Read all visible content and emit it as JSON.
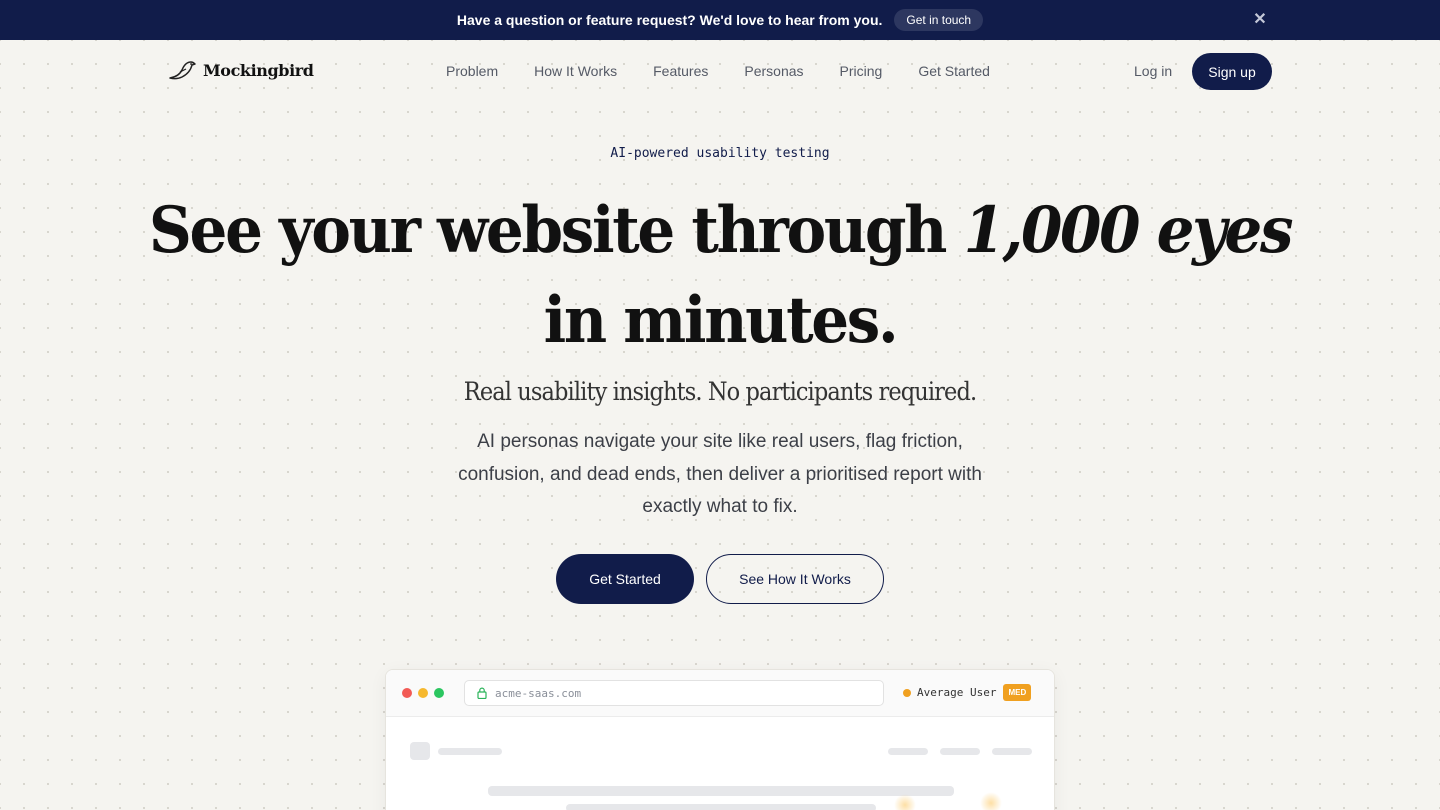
{
  "announcement": {
    "message": "Have a question or feature request? We'd love to hear from you.",
    "cta_label": "Get in touch",
    "close_icon": "close-icon"
  },
  "header": {
    "logo_text": "Mockingbird",
    "logo_icon": "bird-icon",
    "nav": [
      {
        "label": "Problem"
      },
      {
        "label": "How It Works"
      },
      {
        "label": "Features"
      },
      {
        "label": "Personas"
      },
      {
        "label": "Pricing"
      },
      {
        "label": "Get Started"
      }
    ],
    "login_label": "Log in",
    "signup_label": "Sign up"
  },
  "hero": {
    "eyebrow": "AI-powered usability testing",
    "headline_part1": "See your website through ",
    "headline_emphasis": "1,000 eyes",
    "headline_part2": "in minutes.",
    "subhead": "Real usability insights. No participants required.",
    "body": "AI personas navigate your site like real users, flag friction, confusion, and dead ends, then deliver a prioritised report with exactly what to fix.",
    "primary_cta": "Get Started",
    "secondary_cta": "See How It Works"
  },
  "mockup": {
    "url": "acme-saas.com",
    "lock_icon": "lock-icon",
    "persona_label": "Average User",
    "persona_badge": "MED"
  },
  "colors": {
    "navy": "#111c4a",
    "background": "#f5f4f0",
    "persona_accent": "#f0a020"
  }
}
